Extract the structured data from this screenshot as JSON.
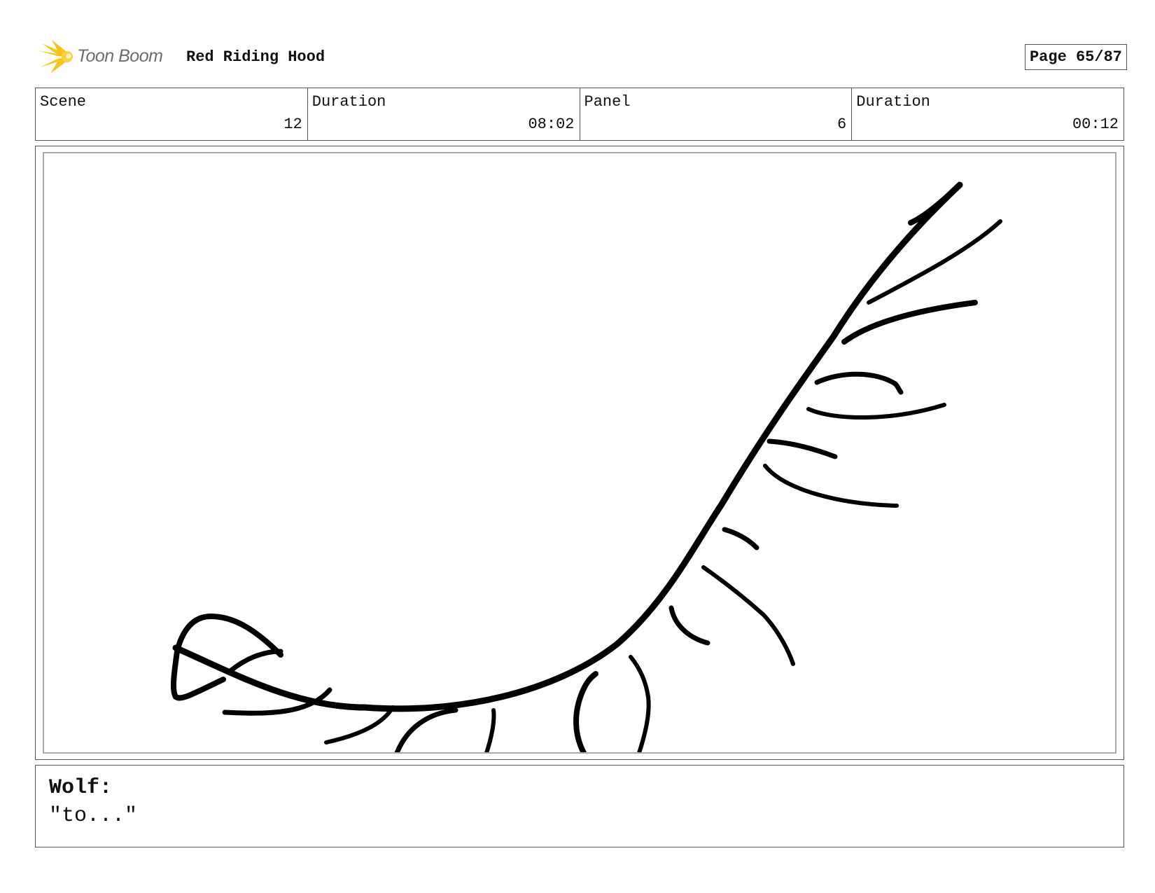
{
  "header": {
    "logo_text": "Toon Boom",
    "project_title": "Red Riding Hood",
    "page_label": "Page 65/87"
  },
  "info": {
    "scene_label": "Scene",
    "scene_value": "12",
    "scene_duration_label": "Duration",
    "scene_duration_value": "08:02",
    "panel_label": "Panel",
    "panel_value": "6",
    "panel_duration_label": "Duration",
    "panel_duration_value": "00:12"
  },
  "dialog": {
    "speaker": "Wolf:",
    "line": "\"to...\""
  },
  "colors": {
    "logo_star": "#f5c518",
    "logo_text": "#6d6d6d",
    "border": "#555555",
    "stroke": "#000000"
  }
}
